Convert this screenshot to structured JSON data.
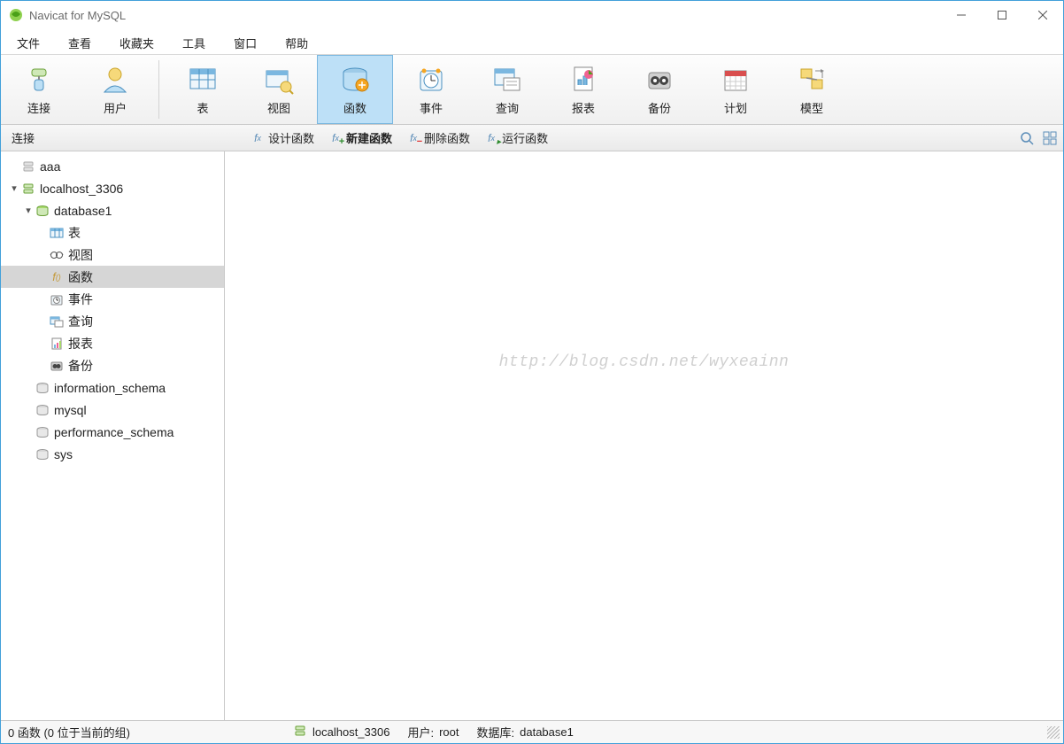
{
  "window": {
    "title": "Navicat for MySQL"
  },
  "menu": {
    "file": "文件",
    "view": "查看",
    "favorites": "收藏夹",
    "tools": "工具",
    "window": "窗口",
    "help": "帮助"
  },
  "toolbar": {
    "connect": "连接",
    "users": "用户",
    "tables": "表",
    "views": "视图",
    "functions": "函数",
    "events": "事件",
    "queries": "查询",
    "reports": "报表",
    "backup": "备份",
    "schedule": "计划",
    "model": "模型"
  },
  "subbar": {
    "label": "连接",
    "design": "设计函数",
    "new": "新建函数",
    "delete": "删除函数",
    "run": "运行函数"
  },
  "tree": {
    "aaa": "aaa",
    "localhost": "localhost_3306",
    "database1": "database1",
    "tables": "表",
    "views": "视图",
    "functions": "函数",
    "events": "事件",
    "queries": "查询",
    "reports": "报表",
    "backup": "备份",
    "info_schema": "information_schema",
    "mysql": "mysql",
    "perf_schema": "performance_schema",
    "sys": "sys"
  },
  "watermark": "http://blog.csdn.net/wyxeainn",
  "status": {
    "left": "0 函数 (0 位于当前的组)",
    "host": "localhost_3306",
    "user_label": "用户: ",
    "user": "root",
    "db_label": "数据库: ",
    "db": "database1"
  }
}
